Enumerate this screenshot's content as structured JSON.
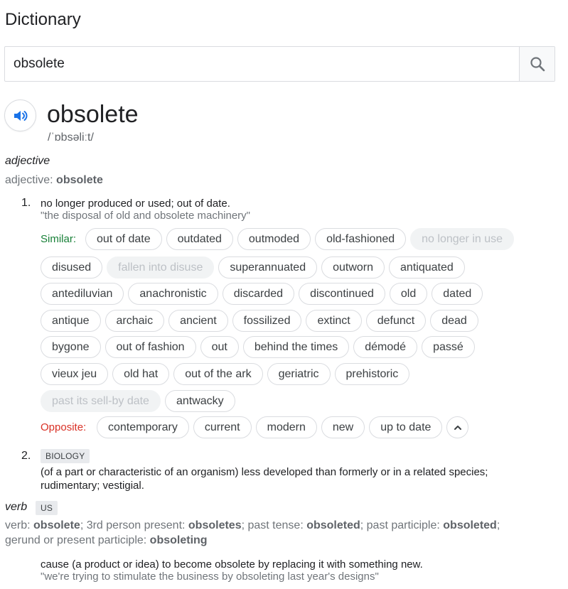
{
  "title": "Dictionary",
  "search": {
    "value": "obsolete",
    "button_icon": "search-icon"
  },
  "entry": {
    "word": "obsolete",
    "phonetic": "/ˈɒbsəliːt/",
    "speaker_icon": "speaker-icon"
  },
  "adjective": {
    "pos": "adjective",
    "forms_prefix": "adjective: ",
    "forms_word": "obsolete",
    "sense1": {
      "number": "1.",
      "definition": "no longer produced or used; out of date.",
      "example": "\"the disposal of old and obsolete machinery\"",
      "similar_label": "Similar:",
      "similar_rows": [
        [
          {
            "text": "out of date",
            "muted": false
          },
          {
            "text": "outdated",
            "muted": false
          },
          {
            "text": "outmoded",
            "muted": false
          },
          {
            "text": "old-fashioned",
            "muted": false
          },
          {
            "text": "no longer in use",
            "muted": true
          }
        ],
        [
          {
            "text": "disused",
            "muted": false
          },
          {
            "text": "fallen into disuse",
            "muted": true
          },
          {
            "text": "superannuated",
            "muted": false
          },
          {
            "text": "outworn",
            "muted": false
          },
          {
            "text": "antiquated",
            "muted": false
          }
        ],
        [
          {
            "text": "antediluvian",
            "muted": false
          },
          {
            "text": "anachronistic",
            "muted": false
          },
          {
            "text": "discarded",
            "muted": false
          },
          {
            "text": "discontinued",
            "muted": false
          },
          {
            "text": "old",
            "muted": false
          },
          {
            "text": "dated",
            "muted": false
          }
        ],
        [
          {
            "text": "antique",
            "muted": false
          },
          {
            "text": "archaic",
            "muted": false
          },
          {
            "text": "ancient",
            "muted": false
          },
          {
            "text": "fossilized",
            "muted": false
          },
          {
            "text": "extinct",
            "muted": false
          },
          {
            "text": "defunct",
            "muted": false
          },
          {
            "text": "dead",
            "muted": false
          }
        ],
        [
          {
            "text": "bygone",
            "muted": false
          },
          {
            "text": "out of fashion",
            "muted": false
          },
          {
            "text": "out",
            "muted": false
          },
          {
            "text": "behind the times",
            "muted": false
          },
          {
            "text": "démodé",
            "muted": false
          },
          {
            "text": "passé",
            "muted": false
          }
        ],
        [
          {
            "text": "vieux jeu",
            "muted": false
          },
          {
            "text": "old hat",
            "muted": false
          },
          {
            "text": "out of the ark",
            "muted": false
          },
          {
            "text": "geriatric",
            "muted": false
          },
          {
            "text": "prehistoric",
            "muted": false
          }
        ],
        [
          {
            "text": "past its sell-by date",
            "muted": true
          },
          {
            "text": "antwacky",
            "muted": false
          }
        ]
      ],
      "opposite_label": "Opposite:",
      "opposite": [
        "contemporary",
        "current",
        "modern",
        "new",
        "up to date"
      ],
      "collapse_icon": "chevron-up-icon"
    },
    "sense2": {
      "number": "2.",
      "tag": "BIOLOGY",
      "definition_line1": "(of a part or characteristic of an organism) less developed than formerly or in a related species;",
      "definition_line2": "rudimentary; vestigial."
    }
  },
  "verb": {
    "pos": "verb",
    "tag": "US",
    "forms": [
      {
        "label": "verb: ",
        "value": "obsolete",
        "sep": "; "
      },
      {
        "label": "3rd person present: ",
        "value": "obsoletes",
        "sep": "; "
      },
      {
        "label": "past tense: ",
        "value": "obsoleted",
        "sep": "; "
      },
      {
        "label": "past participle: ",
        "value": "obsoleted",
        "sep": ";"
      }
    ],
    "forms_line2_label": "gerund or present participle: ",
    "forms_line2_value": "obsoleting",
    "definition": "cause (a product or idea) to become obsolete by replacing it with something new.",
    "example": "\"we're trying to stimulate the business by obsoleting last year's designs\""
  }
}
